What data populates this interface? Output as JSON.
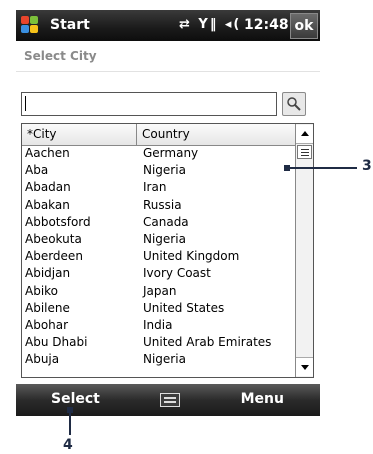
{
  "titlebar": {
    "app_title": "Start",
    "time": "12:48",
    "ok_label": "ok",
    "status_icons": "⇄ Y‖ ◂("
  },
  "header": {
    "title": "Select City"
  },
  "search": {
    "value": "",
    "button_icon": "search-icon"
  },
  "list": {
    "columns": [
      "*City",
      "Country"
    ],
    "rows": [
      [
        "Aachen",
        "Germany"
      ],
      [
        "Aba",
        "Nigeria"
      ],
      [
        "Abadan",
        "Iran"
      ],
      [
        "Abakan",
        "Russia"
      ],
      [
        "Abbotsford",
        "Canada"
      ],
      [
        "Abeokuta",
        "Nigeria"
      ],
      [
        "Aberdeen",
        "United Kingdom"
      ],
      [
        "Abidjan",
        "Ivory Coast"
      ],
      [
        "Abiko",
        "Japan"
      ],
      [
        "Abilene",
        "United States"
      ],
      [
        "Abohar",
        "India"
      ],
      [
        "Abu Dhabi",
        "United Arab Emirates"
      ],
      [
        "Abuja",
        "Nigeria"
      ]
    ]
  },
  "menubar": {
    "left_label": "Select",
    "right_label": "Menu",
    "center_icon": "keyboard-icon"
  },
  "callouts": {
    "scroll_marker": "3",
    "select_marker": "4"
  },
  "colors": {
    "callout": "#1f2b44",
    "titlebar": "#1a1a1a"
  }
}
